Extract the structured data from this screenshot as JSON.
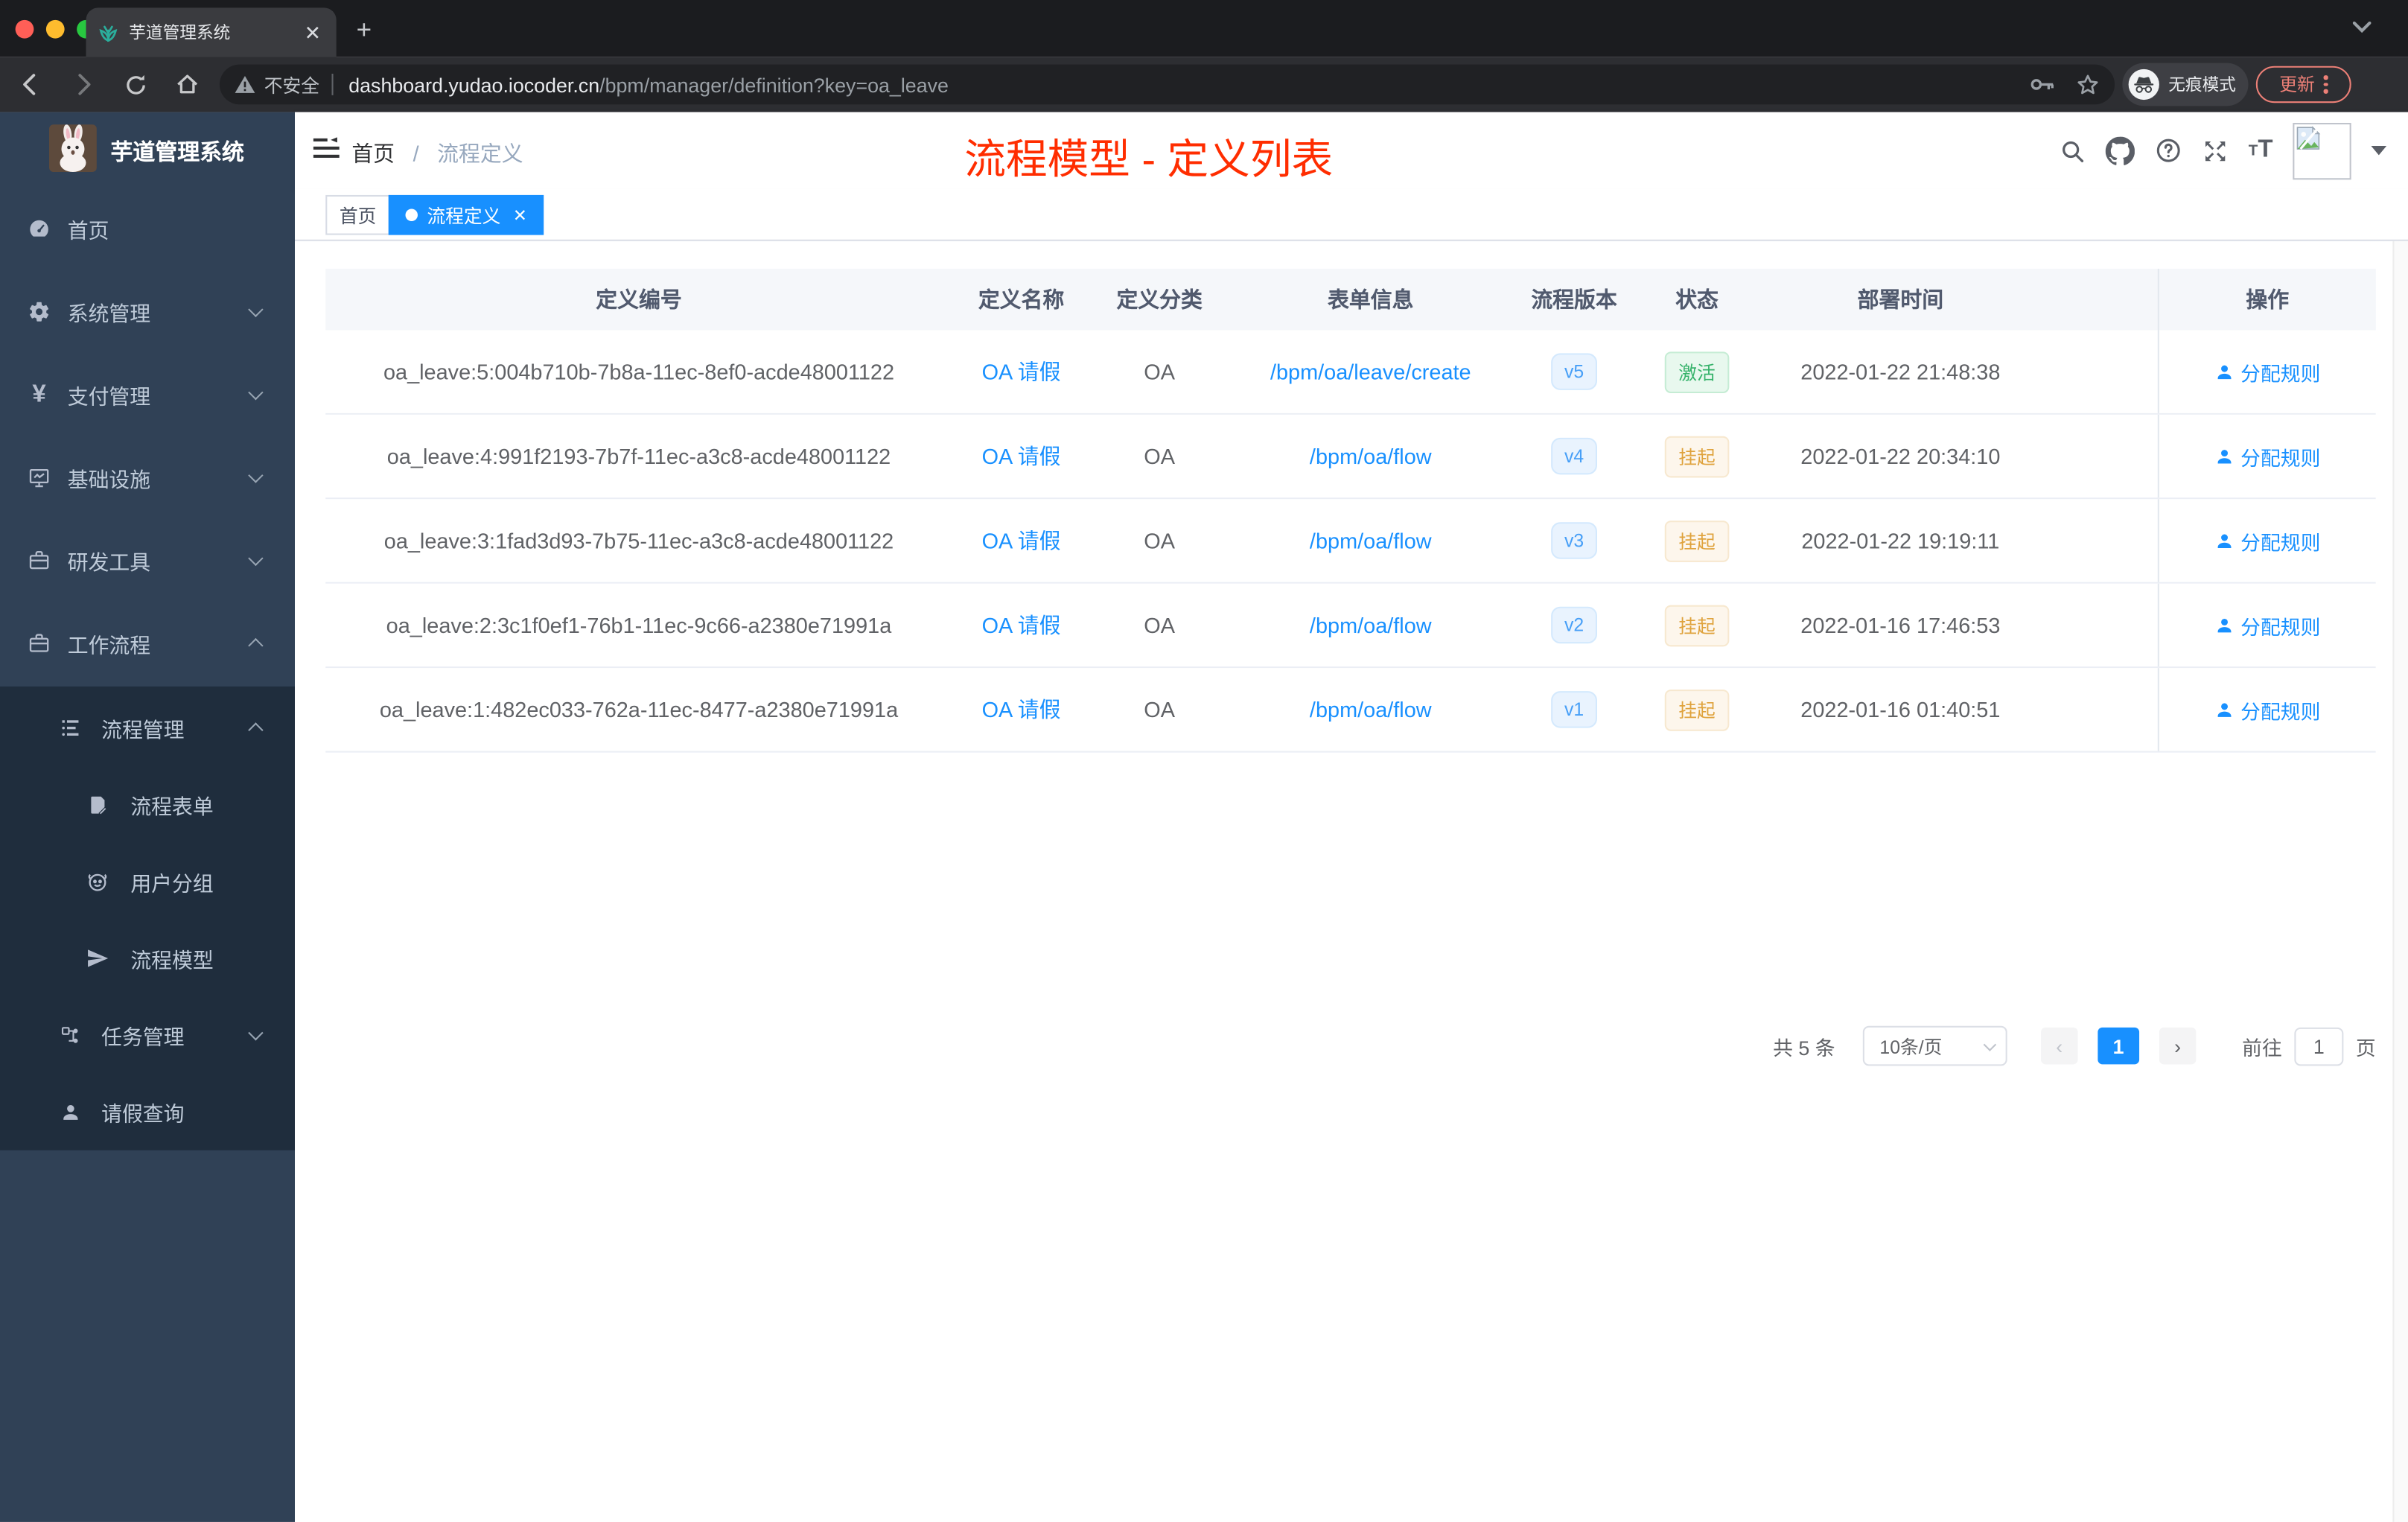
{
  "browser": {
    "tab_title": "芋道管理系统",
    "security_label": "不安全",
    "url_host": "dashboard.yudao.iocoder.cn",
    "url_path": "/bpm/manager/definition?key=oa_leave",
    "incognito_label": "无痕模式",
    "update_label": "更新"
  },
  "sidebar": {
    "brand": "芋道管理系统",
    "items": [
      {
        "label": "首页"
      },
      {
        "label": "系统管理"
      },
      {
        "label": "支付管理"
      },
      {
        "label": "基础设施"
      },
      {
        "label": "研发工具"
      },
      {
        "label": "工作流程"
      }
    ],
    "sub_items": [
      {
        "label": "流程管理"
      },
      {
        "label": "流程表单"
      },
      {
        "label": "用户分组"
      },
      {
        "label": "流程模型"
      },
      {
        "label": "任务管理"
      },
      {
        "label": "请假查询"
      }
    ]
  },
  "navbar": {
    "breadcrumb": {
      "home": "首页",
      "sep": "/",
      "current": "流程定义"
    },
    "annotation": "流程模型 - 定义列表"
  },
  "tags": {
    "home": "首页",
    "active": "流程定义"
  },
  "table": {
    "columns": [
      "定义编号",
      "定义名称",
      "定义分类",
      "表单信息",
      "流程版本",
      "状态",
      "部署时间",
      "操作"
    ],
    "action_label": "分配规则",
    "rows": [
      {
        "id": "oa_leave:5:004b710b-7b8a-11ec-8ef0-acde48001122",
        "name": "OA 请假",
        "category": "OA",
        "form": "/bpm/oa/leave/create",
        "version": "v5",
        "status": "激活",
        "status_type": "active",
        "time": "2022-01-22 21:48:38"
      },
      {
        "id": "oa_leave:4:991f2193-7b7f-11ec-a3c8-acde48001122",
        "name": "OA 请假",
        "category": "OA",
        "form": "/bpm/oa/flow",
        "version": "v4",
        "status": "挂起",
        "status_type": "suspended",
        "time": "2022-01-22 20:34:10"
      },
      {
        "id": "oa_leave:3:1fad3d93-7b75-11ec-a3c8-acde48001122",
        "name": "OA 请假",
        "category": "OA",
        "form": "/bpm/oa/flow",
        "version": "v3",
        "status": "挂起",
        "status_type": "suspended",
        "time": "2022-01-22 19:19:11"
      },
      {
        "id": "oa_leave:2:3c1f0ef1-76b1-11ec-9c66-a2380e71991a",
        "name": "OA 请假",
        "category": "OA",
        "form": "/bpm/oa/flow",
        "version": "v2",
        "status": "挂起",
        "status_type": "suspended",
        "time": "2022-01-16 17:46:53"
      },
      {
        "id": "oa_leave:1:482ec033-762a-11ec-8477-a2380e71991a",
        "name": "OA 请假",
        "category": "OA",
        "form": "/bpm/oa/flow",
        "version": "v1",
        "status": "挂起",
        "status_type": "suspended",
        "time": "2022-01-16 01:40:51"
      }
    ]
  },
  "pagination": {
    "total": "共 5 条",
    "page_size": "10条/页",
    "page": "1",
    "goto": "前往",
    "goto_value": "1",
    "unit": "页"
  }
}
